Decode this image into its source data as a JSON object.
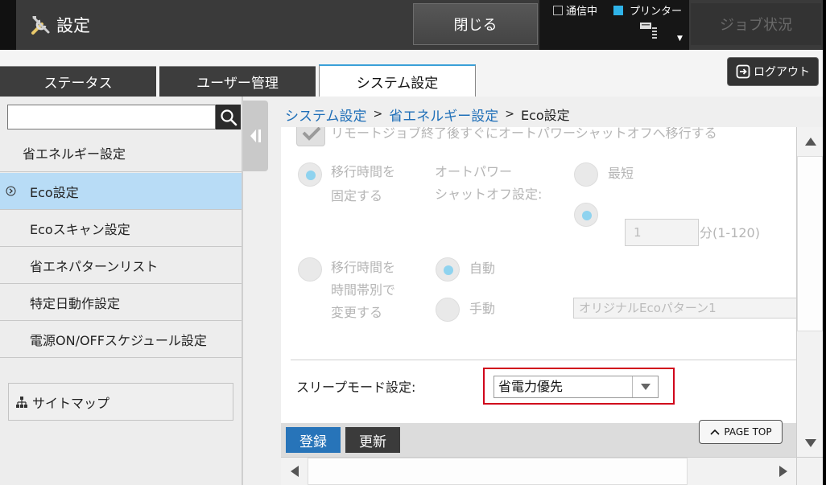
{
  "colors": {
    "accent": "#2774b9",
    "link": "#1f6fb8",
    "selected_item": "#b8dcf6",
    "printer_status": "#2fb3e8",
    "highlight_box": "#d0021b"
  },
  "header": {
    "title": "設定",
    "title_icon": "tools-icon",
    "close_label": "閉じる",
    "status": {
      "comm_label": "通信中",
      "printer_label": "プリンター"
    },
    "job_status_label": "ジョブ状況"
  },
  "tabs": [
    {
      "label": "ステータス",
      "active": false
    },
    {
      "label": "ユーザー管理",
      "active": false
    },
    {
      "label": "システム設定",
      "active": true
    }
  ],
  "logout_label": "ログアウト",
  "sidebar": {
    "search": {
      "value": "",
      "placeholder": ""
    },
    "heading": "省エネルギー設定",
    "items": [
      {
        "label": "Eco設定",
        "selected": true
      },
      {
        "label": "Ecoスキャン設定",
        "selected": false
      },
      {
        "label": "省エネパターンリスト",
        "selected": false
      },
      {
        "label": "特定日動作設定",
        "selected": false
      },
      {
        "label": "電源ON/OFFスケジュール設定",
        "selected": false
      }
    ],
    "sitemap_label": "サイトマップ"
  },
  "breadcrumb": {
    "items": [
      "システム設定",
      "省エネルギー設定"
    ],
    "separator": ">",
    "current": "Eco設定"
  },
  "content": {
    "top_cut_label": "リモートジョブ終了後すぐにオートパワーシャットオフへ移行する",
    "fixed_time": {
      "label_line1": "移行時間を",
      "label_line2": "固定する",
      "apo_label_line1": "オートパワー",
      "apo_label_line2": "シャットオフ設定:",
      "shortest_label": "最短",
      "minutes_value": "1",
      "minutes_suffix": "分(1-120)"
    },
    "time_band": {
      "label_line1": "移行時間を",
      "label_line2": "時間帯別で",
      "label_line3": "変更する",
      "auto_label": "自動",
      "manual_label": "手動",
      "pattern_value": "オリジナルEcoパターン1"
    },
    "sleep_mode": {
      "label": "スリープモード設定:",
      "value": "省電力優先"
    }
  },
  "actions": {
    "register_label": "登録",
    "update_label": "更新",
    "page_top_label": "PAGE TOP"
  }
}
